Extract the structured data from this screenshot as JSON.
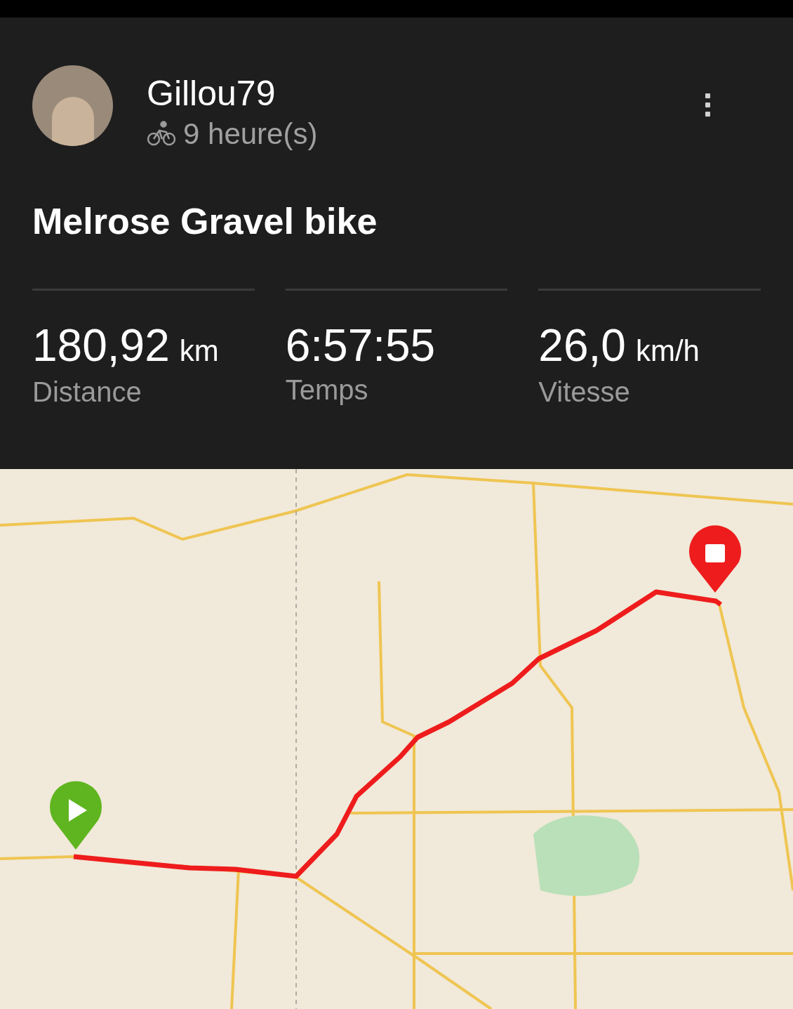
{
  "activity": {
    "user": "Gillou79",
    "elapsed": "9 heure(s)",
    "title": "Melrose Gravel bike"
  },
  "stats": [
    {
      "value": "180,92",
      "unit": "km",
      "label": "Distance"
    },
    {
      "value": "6:57:55",
      "label": "Temps"
    },
    {
      "value": "26,0",
      "unit": "km/h",
      "label": "Vitesse"
    }
  ]
}
